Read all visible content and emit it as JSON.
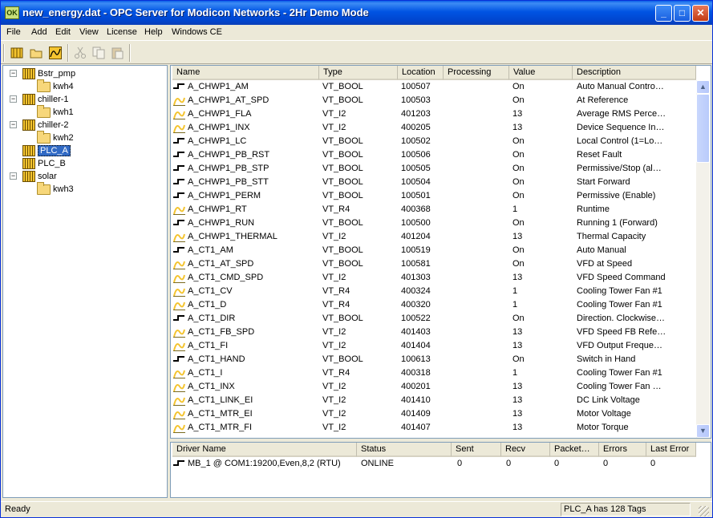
{
  "window": {
    "title": "new_energy.dat - OPC Server for Modicon Networks - 2Hr Demo Mode",
    "app_icon": "OK"
  },
  "menu": [
    "File",
    "Add",
    "Edit",
    "View",
    "License",
    "Help",
    "Windows CE"
  ],
  "toolbar": [
    "new-device-icon",
    "open-folder-icon",
    "trend-icon",
    "cut-icon",
    "copy-icon",
    "paste-icon"
  ],
  "tree": [
    {
      "label": "Bstr_pmp",
      "type": "device",
      "depth": 0,
      "expanded": true
    },
    {
      "label": "kwh4",
      "type": "folder",
      "depth": 1
    },
    {
      "label": "chiller-1",
      "type": "device",
      "depth": 0,
      "expanded": true
    },
    {
      "label": "kwh1",
      "type": "folder",
      "depth": 1
    },
    {
      "label": "chiller-2",
      "type": "device",
      "depth": 0,
      "expanded": true
    },
    {
      "label": "kwh2",
      "type": "folder",
      "depth": 1
    },
    {
      "label": "PLC_A",
      "type": "device",
      "depth": 0,
      "selected": true
    },
    {
      "label": "PLC_B",
      "type": "device",
      "depth": 0
    },
    {
      "label": "solar",
      "type": "device",
      "depth": 0,
      "expanded": true
    },
    {
      "label": "kwh3",
      "type": "folder",
      "depth": 1
    }
  ],
  "tag_columns": [
    "Name",
    "Type",
    "Location",
    "Processing",
    "Value",
    "Description"
  ],
  "tags": [
    {
      "icon": "bool",
      "name": "A_CHWP1_AM",
      "type": "VT_BOOL",
      "location": "100507",
      "processing": "",
      "value": "On",
      "description": "Auto Manual Contro…"
    },
    {
      "icon": "analog",
      "name": "A_CHWP1_AT_SPD",
      "type": "VT_BOOL",
      "location": "100503",
      "processing": "",
      "value": "On",
      "description": "At Reference"
    },
    {
      "icon": "analog",
      "name": "A_CHWP1_FLA",
      "type": "VT_I2",
      "location": "401203",
      "processing": "",
      "value": "13",
      "description": "Average RMS Perce…"
    },
    {
      "icon": "analog",
      "name": "A_CHWP1_INX",
      "type": "VT_I2",
      "location": "400205",
      "processing": "",
      "value": "13",
      "description": "Device Sequence In…"
    },
    {
      "icon": "bool",
      "name": "A_CHWP1_LC",
      "type": "VT_BOOL",
      "location": "100502",
      "processing": "",
      "value": "On",
      "description": "Local Control (1=Lo…"
    },
    {
      "icon": "bool",
      "name": "A_CHWP1_PB_RST",
      "type": "VT_BOOL",
      "location": "100506",
      "processing": "",
      "value": "On",
      "description": "Reset Fault"
    },
    {
      "icon": "bool",
      "name": "A_CHWP1_PB_STP",
      "type": "VT_BOOL",
      "location": "100505",
      "processing": "",
      "value": "On",
      "description": "Permissive/Stop (al…"
    },
    {
      "icon": "bool",
      "name": "A_CHWP1_PB_STT",
      "type": "VT_BOOL",
      "location": "100504",
      "processing": "",
      "value": "On",
      "description": "Start Forward"
    },
    {
      "icon": "bool",
      "name": "A_CHWP1_PERM",
      "type": "VT_BOOL",
      "location": "100501",
      "processing": "",
      "value": "On",
      "description": "Permissive (Enable)"
    },
    {
      "icon": "analog",
      "name": "A_CHWP1_RT",
      "type": "VT_R4",
      "location": "400368",
      "processing": "",
      "value": "1",
      "description": "Runtime"
    },
    {
      "icon": "bool",
      "name": "A_CHWP1_RUN",
      "type": "VT_BOOL",
      "location": "100500",
      "processing": "",
      "value": "On",
      "description": "Running 1 (Forward)"
    },
    {
      "icon": "analog",
      "name": "A_CHWP1_THERMAL",
      "type": "VT_I2",
      "location": "401204",
      "processing": "",
      "value": "13",
      "description": "Thermal Capacity"
    },
    {
      "icon": "bool",
      "name": "A_CT1_AM",
      "type": "VT_BOOL",
      "location": "100519",
      "processing": "",
      "value": "On",
      "description": "Auto Manual"
    },
    {
      "icon": "analog",
      "name": "A_CT1_AT_SPD",
      "type": "VT_BOOL",
      "location": "100581",
      "processing": "",
      "value": "On",
      "description": "VFD at Speed"
    },
    {
      "icon": "analog",
      "name": "A_CT1_CMD_SPD",
      "type": "VT_I2",
      "location": "401303",
      "processing": "",
      "value": "13",
      "description": "VFD Speed Command"
    },
    {
      "icon": "analog",
      "name": "A_CT1_CV",
      "type": "VT_R4",
      "location": "400324",
      "processing": "",
      "value": "1",
      "description": "Cooling Tower Fan #1"
    },
    {
      "icon": "analog",
      "name": "A_CT1_D",
      "type": "VT_R4",
      "location": "400320",
      "processing": "",
      "value": "1",
      "description": "Cooling Tower Fan #1"
    },
    {
      "icon": "bool",
      "name": "A_CT1_DIR",
      "type": "VT_BOOL",
      "location": "100522",
      "processing": "",
      "value": "On",
      "description": "Direction. Clockwise…"
    },
    {
      "icon": "analog",
      "name": "A_CT1_FB_SPD",
      "type": "VT_I2",
      "location": "401403",
      "processing": "",
      "value": "13",
      "description": "VFD Speed FB Refe…"
    },
    {
      "icon": "analog",
      "name": "A_CT1_FI",
      "type": "VT_I2",
      "location": "401404",
      "processing": "",
      "value": "13",
      "description": "VFD Output Freque…"
    },
    {
      "icon": "bool",
      "name": "A_CT1_HAND",
      "type": "VT_BOOL",
      "location": "100613",
      "processing": "",
      "value": "On",
      "description": "Switch in Hand"
    },
    {
      "icon": "analog",
      "name": "A_CT1_I",
      "type": "VT_R4",
      "location": "400318",
      "processing": "",
      "value": "1",
      "description": "Cooling Tower Fan #1"
    },
    {
      "icon": "analog",
      "name": "A_CT1_INX",
      "type": "VT_I2",
      "location": "400201",
      "processing": "",
      "value": "13",
      "description": "Cooling Tower Fan …"
    },
    {
      "icon": "analog",
      "name": "A_CT1_LINK_EI",
      "type": "VT_I2",
      "location": "401410",
      "processing": "",
      "value": "13",
      "description": "DC Link Voltage"
    },
    {
      "icon": "analog",
      "name": "A_CT1_MTR_EI",
      "type": "VT_I2",
      "location": "401409",
      "processing": "",
      "value": "13",
      "description": "Motor Voltage"
    },
    {
      "icon": "analog",
      "name": "A_CT1_MTR_FI",
      "type": "VT_I2",
      "location": "401407",
      "processing": "",
      "value": "13",
      "description": "Motor Torque"
    }
  ],
  "driver_columns": [
    "Driver Name",
    "Status",
    "Sent",
    "Recv",
    "Packet…",
    "Errors",
    "Last Error"
  ],
  "drivers": [
    {
      "name": "MB_1   @ COM1:19200,Even,8,2 (RTU)",
      "status": "ONLINE",
      "sent": "0",
      "recv": "0",
      "packet": "0",
      "errors": "0",
      "last_error": "0"
    }
  ],
  "status": {
    "left": "Ready",
    "right": "PLC_A has 128 Tags"
  },
  "colors": {
    "titlebar": "#0054e3",
    "selection": "#316ac5",
    "analog_icon": "#f4c430"
  }
}
